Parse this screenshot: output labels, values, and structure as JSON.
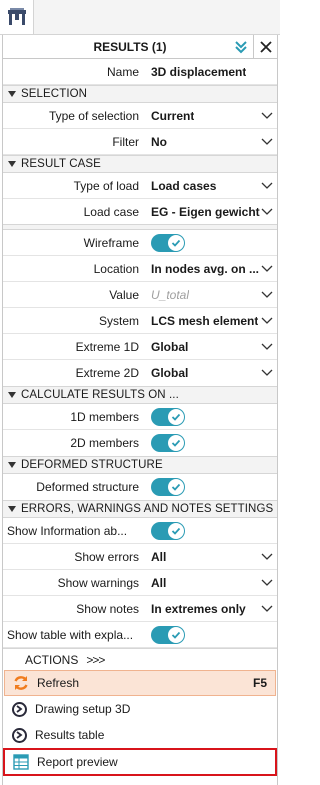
{
  "app": {
    "tab_icon": "scia-structure-icon"
  },
  "panel": {
    "title": "RESULTS (1)",
    "name_label": "Name",
    "name_value": "3D displacement"
  },
  "selection": {
    "header": "SELECTION",
    "type_label": "Type of selection",
    "type_value": "Current",
    "filter_label": "Filter",
    "filter_value": "No"
  },
  "result_case": {
    "header": "RESULT CASE",
    "type_load_label": "Type of load",
    "type_load_value": "Load cases",
    "load_case_label": "Load case",
    "load_case_value": "EG - Eigen gewicht"
  },
  "display": {
    "wireframe_label": "Wireframe",
    "wireframe_on": true,
    "location_label": "Location",
    "location_value": "In nodes avg. on ...",
    "value_label": "Value",
    "value_value": "U_total",
    "system_label": "System",
    "system_value": "LCS mesh element",
    "extreme1d_label": "Extreme 1D",
    "extreme1d_value": "Global",
    "extreme2d_label": "Extreme 2D",
    "extreme2d_value": "Global"
  },
  "calculate": {
    "header": "CALCULATE RESULTS ON ...",
    "members1d_label": "1D members",
    "members1d_on": true,
    "members2d_label": "2D members",
    "members2d_on": true
  },
  "deformed": {
    "header": "DEFORMED STRUCTURE",
    "label": "Deformed structure",
    "on": true
  },
  "errors": {
    "header": "ERRORS, WARNINGS AND NOTES SETTINGS",
    "show_info_label": "Show Information ab...",
    "show_info_on": true,
    "show_errors_label": "Show errors",
    "show_errors_value": "All",
    "show_warnings_label": "Show warnings",
    "show_warnings_value": "All",
    "show_notes_label": "Show notes",
    "show_notes_value": "In extremes only",
    "show_table_label": "Show table with expla...",
    "show_table_on": true
  },
  "actions": {
    "header": "ACTIONS",
    "arrows": ">>>",
    "refresh_label": "Refresh",
    "refresh_key": "F5",
    "drawing_setup_label": "Drawing setup 3D",
    "results_table_label": "Results table",
    "report_preview_label": "Report preview"
  },
  "colors": {
    "accent": "#2a9bb4",
    "refresh_bg": "#fbe4d6",
    "highlight_border": "#d8141b"
  }
}
